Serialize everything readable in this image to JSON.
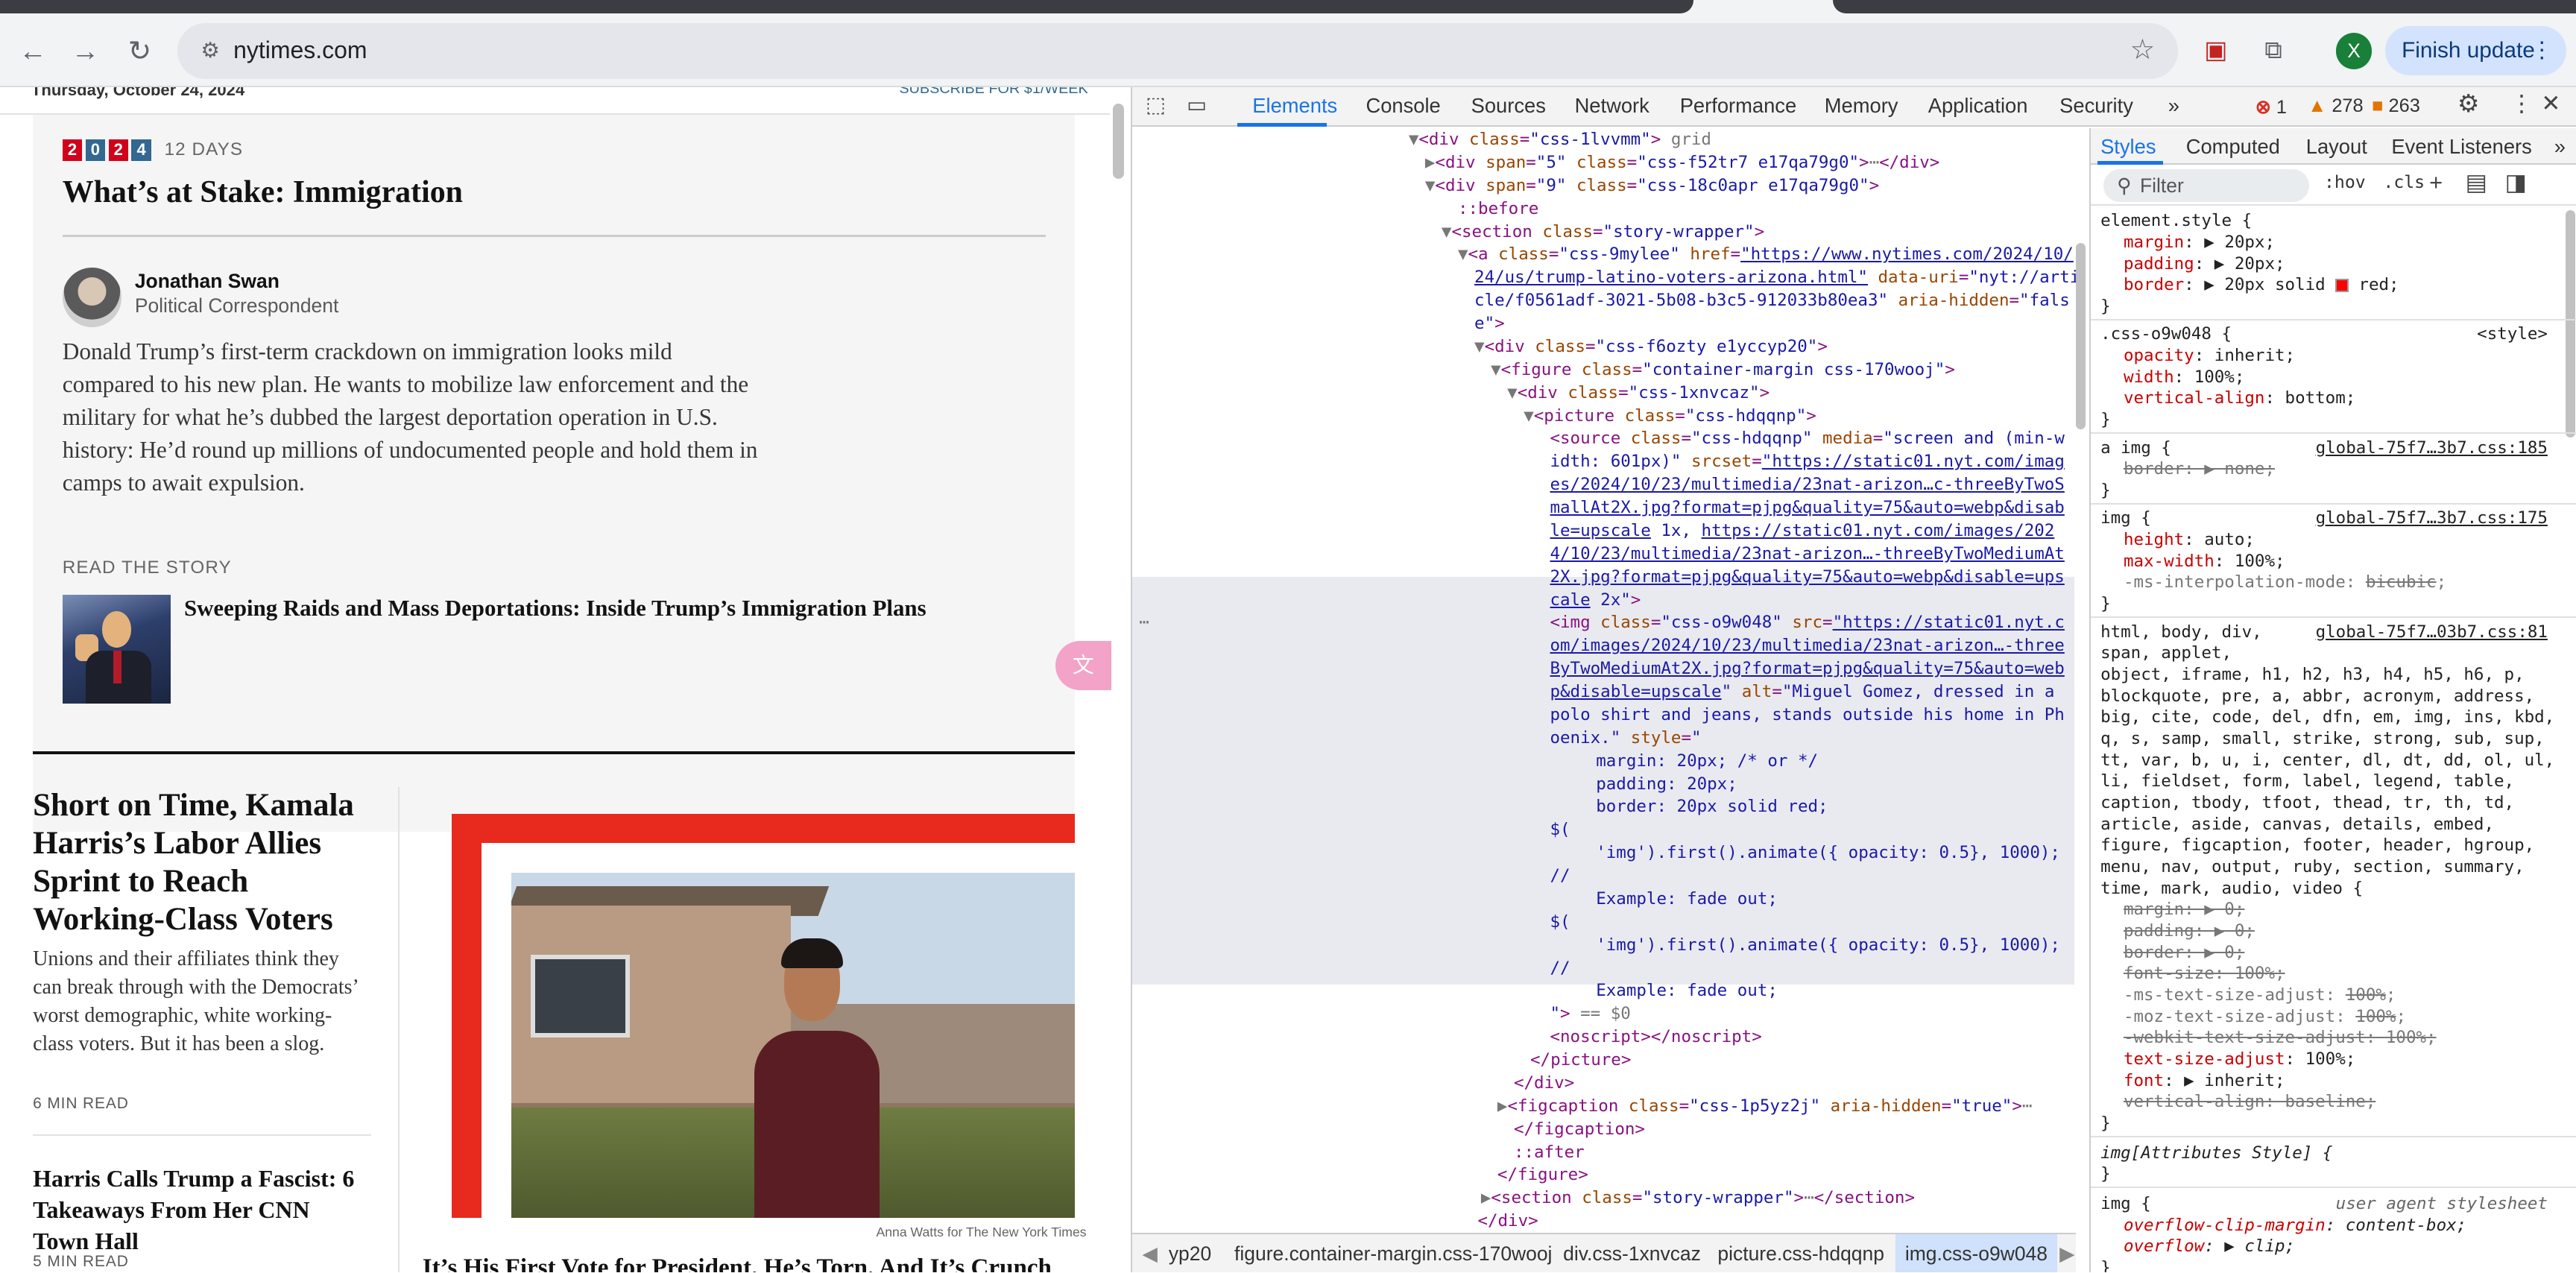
{
  "browser": {
    "url": "nytimes.com",
    "profile_initial": "X",
    "finish_update": "Finish update"
  },
  "page": {
    "date": "Thursday, October 24, 2024",
    "subscribe": "SUBSCRIBE FOR $1/WEEK",
    "badge_digits": [
      "2",
      "0",
      "2",
      "4"
    ],
    "days": "12 DAYS",
    "headline": "What’s at Stake: Immigration",
    "author": "Jonathan Swan",
    "author_role": "Political Correspondent",
    "summary": "Donald Trump’s first-term crackdown on immigration looks mild compared to his new plan. He wants to mobilize law enforcement and the military for what he’s dubbed the largest deportation operation in U.S. history: He’d round up millions of undocumented people and hold them in camps to await expulsion.",
    "read_story": "READ THE STORY",
    "story_link": "Sweeping Raids and Mass Deportations: Inside Trump’s Immigration Plans",
    "article1_title": "Short on Time, Kamala Harris’s Labor Allies Sprint to Reach Working-Class Voters",
    "article1_desc": "Unions and their affiliates think they can break through with the Democrats’ worst demographic, white working-class voters. But it has been a slog.",
    "article1_time": "6 MIN READ",
    "article2_title": "Harris Calls Trump a Fascist: 6 Takeaways From Her CNN Town Hall",
    "article2_time": "5 MIN READ",
    "photo_credit": "Anna Watts for The New York Times",
    "article3_title": "It’s His First Vote for President. He’s Torn. And It’s Crunch"
  },
  "devtools": {
    "tabs": [
      "Elements",
      "Console",
      "Sources",
      "Network",
      "Performance",
      "Memory",
      "Application",
      "Security"
    ],
    "more": "»",
    "errors": "1",
    "warnings": "278",
    "issues": "263",
    "breadcrumbs": [
      "yp20",
      "figure.container-margin.css-170wooj",
      "div.css-1xnvcaz",
      "picture.css-hdqqnp",
      "img.css-o9w048"
    ],
    "styles_tabs": [
      "Styles",
      "Computed",
      "Layout",
      "Event Listeners"
    ],
    "styles_more": "»",
    "filter_placeholder": "Filter",
    "hov": ":hov",
    "cls": ".cls"
  }
}
